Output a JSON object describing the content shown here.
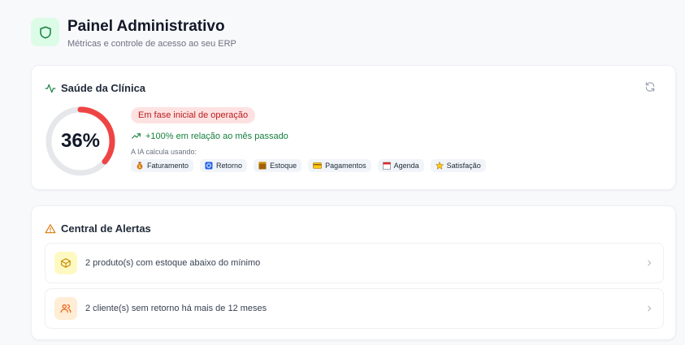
{
  "header": {
    "title": "Painel Administrativo",
    "subtitle": "Métricas e controle de acesso ao seu ERP",
    "icon": "shield-icon"
  },
  "health": {
    "title": "Saúde da Clínica",
    "score": 36,
    "score_label": "36%",
    "status_badge": "Em fase inicial de operação",
    "trend": "+100% em relação ao mês passado",
    "ia_label": "A IA calcula usando:",
    "factors": [
      {
        "label": "Faturamento",
        "icon": "money-bag-icon"
      },
      {
        "label": "Retorno",
        "icon": "refresh-box-icon"
      },
      {
        "label": "Estoque",
        "icon": "box-icon"
      },
      {
        "label": "Pagamentos",
        "icon": "card-icon"
      },
      {
        "label": "Agenda",
        "icon": "calendar-icon"
      },
      {
        "label": "Satisfação",
        "icon": "star-icon"
      }
    ],
    "colors": {
      "gauge": "#ef4444",
      "track": "#e5e7eb",
      "trend": "#15803d"
    }
  },
  "alerts": {
    "title": "Central de Alertas",
    "items": [
      {
        "text": "2 produto(s) com estoque abaixo do mínimo",
        "icon": "package-icon"
      },
      {
        "text": "2 cliente(s) sem retorno há mais de 12 meses",
        "icon": "users-icon"
      }
    ]
  }
}
